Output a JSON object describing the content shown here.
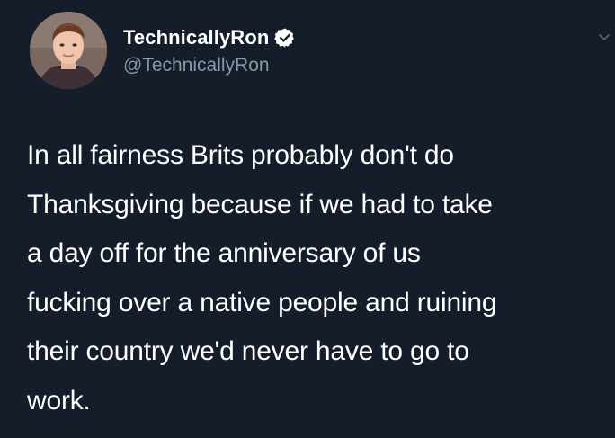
{
  "author": {
    "display_name": "TechnicallyRon",
    "handle": "@TechnicallyRon",
    "verified": true,
    "avatar_icon": "user-avatar"
  },
  "tweet": {
    "text": "In all fairness Brits probably don't do\nThanksgiving because if we had to take\na day off for the anniversary of us\nfucking over a native people and ruining\ntheir country we'd never have to go to\nwork."
  },
  "icons": {
    "verified": "verified-badge-icon",
    "menu": "chevron-down-icon"
  },
  "colors": {
    "background": "#141d29",
    "text": "#ffffff",
    "handle": "#8899a6"
  }
}
